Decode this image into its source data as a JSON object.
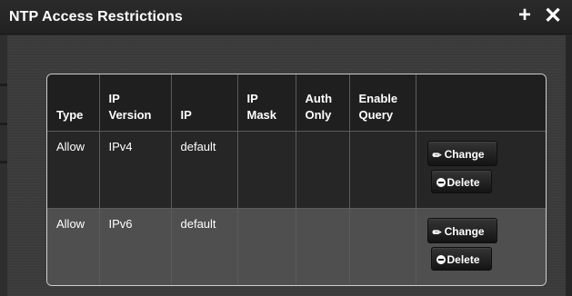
{
  "window": {
    "title": "NTP Access Restrictions",
    "add_label": "+",
    "close_label": "✕"
  },
  "table": {
    "columns": [
      "Type",
      "IP\nVersion",
      "IP",
      "IP\nMask",
      "Auth\nOnly",
      "Enable\nQuery",
      ""
    ],
    "rows": [
      {
        "type": "Allow",
        "ip_version": "IPv4",
        "ip": "default",
        "ip_mask": "",
        "auth_only": "",
        "enable_query": "",
        "change_label": "Change",
        "delete_label": "Delete"
      },
      {
        "type": "Allow",
        "ip_version": "IPv6",
        "ip": "default",
        "ip_mask": "",
        "auth_only": "",
        "enable_query": "",
        "change_label": "Change",
        "delete_label": "Delete"
      }
    ]
  },
  "icons": {
    "add": "plus-icon",
    "close": "close-icon",
    "change": "pencil-icon",
    "delete": "minus-circle-icon"
  },
  "colors": {
    "title_bar": "#222222",
    "panel_background": "#3a3a3a",
    "header_row": "#1f1f1f",
    "row_dark": "#262626",
    "row_light": "#4f4f4f",
    "table_border": "#cfcfcf"
  }
}
